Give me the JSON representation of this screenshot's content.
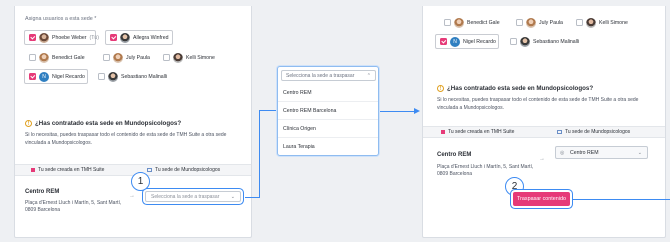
{
  "left": {
    "assign_label": "Asigna usuarios a esta sede *",
    "users": [
      {
        "name": "Phoebe Weber",
        "aux": "(Tú)",
        "checked": true
      },
      {
        "name": "Allegra Winfred",
        "aux": "",
        "checked": true
      },
      {
        "name": "Benedict Gale",
        "aux": "",
        "checked": false
      },
      {
        "name": "July Paula",
        "aux": "",
        "checked": false
      },
      {
        "name": "Kelli Simone",
        "aux": "",
        "checked": false
      },
      {
        "name": "Nigel Recardo",
        "aux": "",
        "checked": true,
        "initial": "N"
      },
      {
        "name": "Sebastiano Malinalli",
        "aux": "",
        "checked": false
      }
    ],
    "question_title": "¿Has contratado esta sede en Mundopsicologos?",
    "question_text": "Si lo necesitas, puedes traspasar todo el contenido de esta sede de TMH Suite a otra sede vinculada a Mundopsicologos.",
    "col_tmh": "Tu sede creada en TMH Suite",
    "col_mundo": "Tu sede de Mundopsicologos",
    "center_name": "Centro REM",
    "address_line1": "Plaça d'Ernest Lluch i Martín, 5, Sant Martí,",
    "address_line2": "0809 Barcelona",
    "select_placeholder": "Selecciona la sede a traspasar"
  },
  "dropdown": {
    "placeholder": "Selecciona la sede a traspasar",
    "options": [
      "Centro REM",
      "Centro REM Barcelona",
      "Clínica Origen",
      "Laura Terapia"
    ]
  },
  "steps": {
    "one": "1",
    "two": "2"
  },
  "right": {
    "users_row1": [
      {
        "name": "Benedict Gale",
        "checked": false
      },
      {
        "name": "July Paula",
        "checked": false
      },
      {
        "name": "Kelli Simone",
        "checked": false
      }
    ],
    "users_row2": [
      {
        "name": "Nigel Recardo",
        "checked": true,
        "initial": "N"
      },
      {
        "name": "Sebastiano Malinalli",
        "checked": false
      }
    ],
    "question_title": "¿Has contratado esta sede en Mundopsicologos?",
    "question_text": "Si lo necesitas, puedes traspasar todo el contenido de esta sede de TMH Suite a otra sede vinculada a Mundopsicologos.",
    "col_tmh": "Tu sede creada en TMH Suite",
    "col_mundo": "Tu sede de Mundopsicologos",
    "center_name": "Centro REM",
    "address_line1": "Plaça d'Ernest Lluch i Martín, 5, Sant Martí,",
    "address_line2": "0809 Barcelona",
    "selected_value": "Centro REM",
    "transfer_button": "Traspasar contenido"
  },
  "colors": {
    "accent": "#e63a78",
    "highlight": "#3d8bf2"
  }
}
